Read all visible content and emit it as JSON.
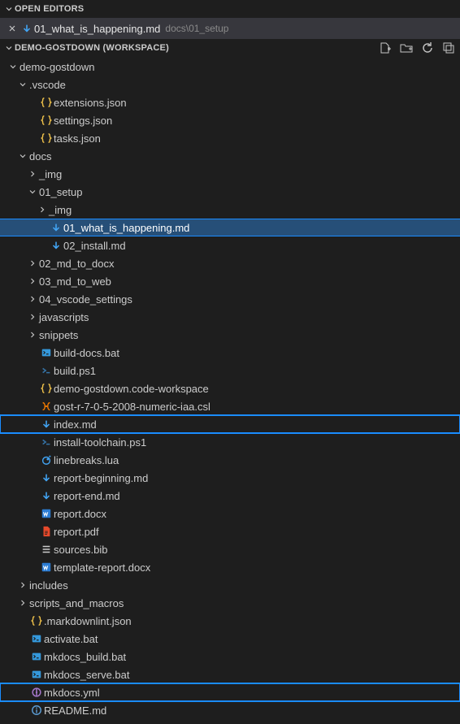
{
  "openEditors": {
    "title": "OPEN EDITORS",
    "tabs": [
      {
        "icon": "markdown-arrow",
        "label": "01_what_is_happening.md",
        "desc": "docs\\01_setup"
      }
    ]
  },
  "workspace": {
    "title": "DEMO-GOSTDOWN (WORKSPACE)"
  },
  "tree": [
    {
      "depth": 0,
      "type": "folder",
      "expanded": true,
      "label": "demo-gostdown"
    },
    {
      "depth": 1,
      "type": "folder",
      "expanded": true,
      "label": ".vscode"
    },
    {
      "depth": 2,
      "type": "file",
      "icon": "json",
      "label": "extensions.json"
    },
    {
      "depth": 2,
      "type": "file",
      "icon": "json",
      "label": "settings.json"
    },
    {
      "depth": 2,
      "type": "file",
      "icon": "json",
      "label": "tasks.json"
    },
    {
      "depth": 1,
      "type": "folder",
      "expanded": true,
      "label": "docs"
    },
    {
      "depth": 2,
      "type": "folder",
      "expanded": false,
      "label": "_img"
    },
    {
      "depth": 2,
      "type": "folder",
      "expanded": true,
      "label": "01_setup"
    },
    {
      "depth": 3,
      "type": "folder",
      "expanded": false,
      "label": "_img"
    },
    {
      "depth": 3,
      "type": "file",
      "icon": "md",
      "label": "01_what_is_happening.md",
      "selected": true
    },
    {
      "depth": 3,
      "type": "file",
      "icon": "md",
      "label": "02_install.md"
    },
    {
      "depth": 2,
      "type": "folder",
      "expanded": false,
      "label": "02_md_to_docx"
    },
    {
      "depth": 2,
      "type": "folder",
      "expanded": false,
      "label": "03_md_to_web"
    },
    {
      "depth": 2,
      "type": "folder",
      "expanded": false,
      "label": "04_vscode_settings"
    },
    {
      "depth": 2,
      "type": "folder",
      "expanded": false,
      "label": "javascripts"
    },
    {
      "depth": 2,
      "type": "folder",
      "expanded": false,
      "label": "snippets"
    },
    {
      "depth": 2,
      "type": "file",
      "icon": "bat",
      "label": "build-docs.bat"
    },
    {
      "depth": 2,
      "type": "file",
      "icon": "ps1",
      "label": "build.ps1"
    },
    {
      "depth": 2,
      "type": "file",
      "icon": "json",
      "label": "demo-gostdown.code-workspace"
    },
    {
      "depth": 2,
      "type": "file",
      "icon": "csl",
      "label": "gost-r-7-0-5-2008-numeric-iaa.csl"
    },
    {
      "depth": 2,
      "type": "file",
      "icon": "md",
      "label": "index.md",
      "highlight": true
    },
    {
      "depth": 2,
      "type": "file",
      "icon": "ps1",
      "label": "install-toolchain.ps1"
    },
    {
      "depth": 2,
      "type": "file",
      "icon": "lua",
      "label": "linebreaks.lua"
    },
    {
      "depth": 2,
      "type": "file",
      "icon": "md",
      "label": "report-beginning.md"
    },
    {
      "depth": 2,
      "type": "file",
      "icon": "md",
      "label": "report-end.md"
    },
    {
      "depth": 2,
      "type": "file",
      "icon": "docx",
      "label": "report.docx"
    },
    {
      "depth": 2,
      "type": "file",
      "icon": "pdf",
      "label": "report.pdf"
    },
    {
      "depth": 2,
      "type": "file",
      "icon": "bib",
      "label": "sources.bib"
    },
    {
      "depth": 2,
      "type": "file",
      "icon": "docx",
      "label": "template-report.docx"
    },
    {
      "depth": 1,
      "type": "folder",
      "expanded": false,
      "label": "includes"
    },
    {
      "depth": 1,
      "type": "folder",
      "expanded": false,
      "label": "scripts_and_macros"
    },
    {
      "depth": 1,
      "type": "file",
      "icon": "json",
      "label": ".markdownlint.json"
    },
    {
      "depth": 1,
      "type": "file",
      "icon": "bat",
      "label": "activate.bat"
    },
    {
      "depth": 1,
      "type": "file",
      "icon": "bat",
      "label": "mkdocs_build.bat"
    },
    {
      "depth": 1,
      "type": "file",
      "icon": "bat",
      "label": "mkdocs_serve.bat"
    },
    {
      "depth": 1,
      "type": "file",
      "icon": "yml",
      "label": "mkdocs.yml",
      "highlight": true
    },
    {
      "depth": 1,
      "type": "file",
      "icon": "readme",
      "label": "README.md"
    }
  ],
  "colors": {
    "json": "#f0c24a",
    "md": "#42a5f5",
    "bat": "#3498db",
    "ps1": "#3572A5",
    "csl": "#f57c00",
    "lua": "#42a5f5",
    "docx": "#2b7cd3",
    "pdf": "#e6492b",
    "bib": "#cccccc",
    "yml": "#a074c4",
    "readme": "#5c9dd5"
  }
}
